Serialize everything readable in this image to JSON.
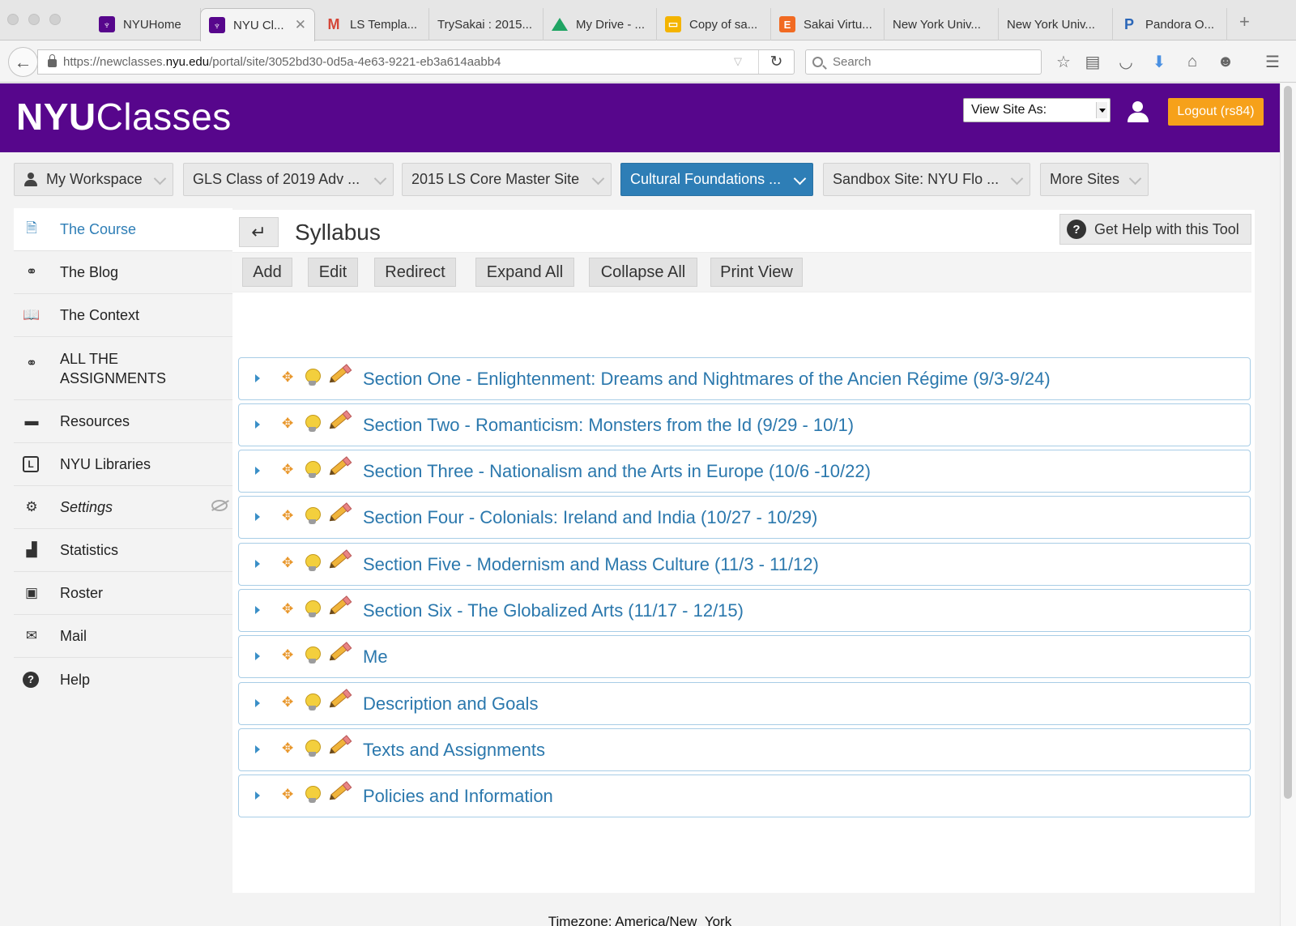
{
  "tabs": [
    {
      "title": "NYUHome",
      "icon": "nyu-icon"
    },
    {
      "title": "NYU Cl...",
      "icon": "nyu-icon",
      "active": true
    },
    {
      "title": "LS Templa...",
      "icon": "gmail-icon"
    },
    {
      "title": "TrySakai : 2015...",
      "icon": ""
    },
    {
      "title": "My Drive - ...",
      "icon": "drive-icon"
    },
    {
      "title": "Copy of sa...",
      "icon": "slides-icon"
    },
    {
      "title": "Sakai Virtu...",
      "icon": "e-icon"
    },
    {
      "title": "New York Univ...",
      "icon": ""
    },
    {
      "title": "New York Univ...",
      "icon": ""
    },
    {
      "title": "Pandora O...",
      "icon": "pandora-icon"
    }
  ],
  "browser": {
    "url_prefix": "https://newclasses.",
    "url_domain": "nyu.edu",
    "url_path": "/portal/site/3052bd30-0d5a-4e63-9221-eb3a614aabb4",
    "search_placeholder": "Search"
  },
  "header": {
    "logo_bold": "NYU",
    "logo_light": "Classes",
    "view_site_as": "View Site As:",
    "logout_label": "Logout (rs84)",
    "brand_color": "#57068c",
    "logout_color": "#f6a11a"
  },
  "sites": [
    {
      "label": "My Workspace"
    },
    {
      "label": "GLS Class of 2019 Adv ..."
    },
    {
      "label": "2015 LS Core Master Site"
    },
    {
      "label": "Cultural Foundations ...",
      "active": true
    },
    {
      "label": "Sandbox Site: NYU Flo ..."
    },
    {
      "label": "More Sites"
    }
  ],
  "tools": [
    {
      "label": "The Course",
      "icon": "document-icon",
      "active": true
    },
    {
      "label": "The Blog",
      "icon": "link-icon"
    },
    {
      "label": "The Context",
      "icon": "book-icon"
    },
    {
      "label": "ALL THE ASSIGNMENTS",
      "icon": "link-icon"
    },
    {
      "label": "Resources",
      "icon": "folder-icon"
    },
    {
      "label": "NYU Libraries",
      "icon": "library-icon"
    },
    {
      "label": "Settings",
      "icon": "gears-icon"
    },
    {
      "label": "Statistics",
      "icon": "bar-chart-icon"
    },
    {
      "label": "Roster",
      "icon": "roster-icon"
    },
    {
      "label": "Mail",
      "icon": "mail-icon"
    },
    {
      "label": "Help",
      "icon": "help-icon"
    }
  ],
  "main": {
    "title": "Syllabus",
    "help_label": "Get Help with this Tool",
    "actions": [
      "Add",
      "Edit",
      "Redirect",
      "Expand All",
      "Collapse All",
      "Print View"
    ],
    "sections": [
      "Section One - Enlightenment: Dreams and Nightmares of the Ancien Régime (9/3-9/24)",
      "Section Two - Romanticism: Monsters from the Id (9/29 - 10/1)",
      "Section Three - Nationalism and the Arts in Europe (10/6 -10/22)",
      "Section Four - Colonials: Ireland and India (10/27 - 10/29)",
      "Section Five - Modernism and Mass Culture (11/3 - 11/12)",
      "Section Six - The Globalized Arts (11/17 - 12/15)",
      "Me",
      "Description and Goals",
      "Texts and Assignments",
      "Policies and Information"
    ]
  },
  "footer": {
    "timezone": "Timezone: America/New_York"
  }
}
